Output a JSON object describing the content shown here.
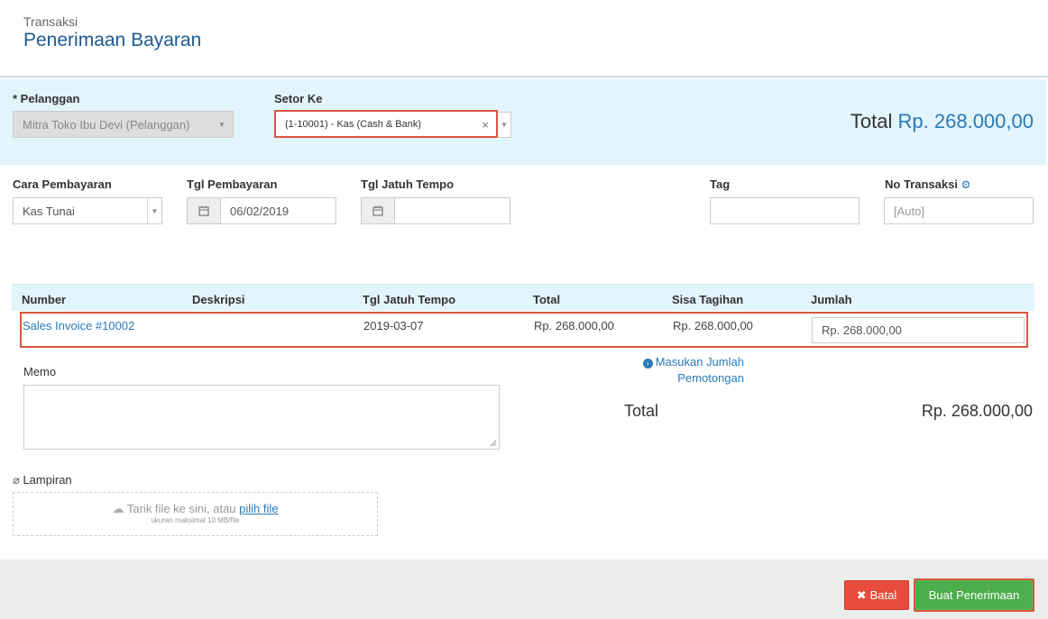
{
  "header": {
    "subtitle": "Transaksi",
    "title": "Penerimaan Bayaran"
  },
  "customer": {
    "label": "* Pelanggan",
    "value": "Mitra Toko Ibu Devi (Pelanggan)"
  },
  "deposit": {
    "label": "Setor Ke",
    "value": "(1-10001) - Kas (Cash & Bank)",
    "clear": "×"
  },
  "total_top": {
    "label": "Total",
    "amount": "Rp. 268.000,00"
  },
  "payment_method": {
    "label": "Cara Pembayaran",
    "value": "Kas Tunai"
  },
  "payment_date": {
    "label": "Tgl Pembayaran",
    "value": "06/02/2019"
  },
  "due_date": {
    "label": "Tgl Jatuh Tempo",
    "value": ""
  },
  "tag": {
    "label": "Tag",
    "value": ""
  },
  "transaction_no": {
    "label": "No Transaksi",
    "placeholder": "[Auto]"
  },
  "table": {
    "headers": [
      "Number",
      "Deskripsi",
      "Tgl Jatuh Tempo",
      "Total",
      "Sisa Tagihan",
      "Jumlah"
    ],
    "rows": [
      {
        "number": "Sales Invoice #10002",
        "description": "",
        "due": "2019-03-07",
        "total": "Rp. 268.000,00",
        "remaining": "Rp. 268.000,00",
        "amount": "Rp. 268.000,00"
      }
    ]
  },
  "memo": {
    "label": "Memo"
  },
  "deduction": {
    "line1": "Masukan Jumlah",
    "line2": "Pemotongan"
  },
  "total_bottom": {
    "label": "Total",
    "amount": "Rp. 268.000,00"
  },
  "attachment": {
    "label": "Lampiran",
    "drop_text": "Tarik file ke sini, atau ",
    "pick_link": "pilih file",
    "note": "ukuran maksimal 10 MB/file"
  },
  "buttons": {
    "cancel": "Batal",
    "submit": "Buat Penerimaan"
  },
  "colors": {
    "accent": "#2a7ab8",
    "title": "#1f5a8f",
    "danger": "#e74c3c",
    "success": "#4cae4c",
    "highlight": "#d9553f"
  }
}
